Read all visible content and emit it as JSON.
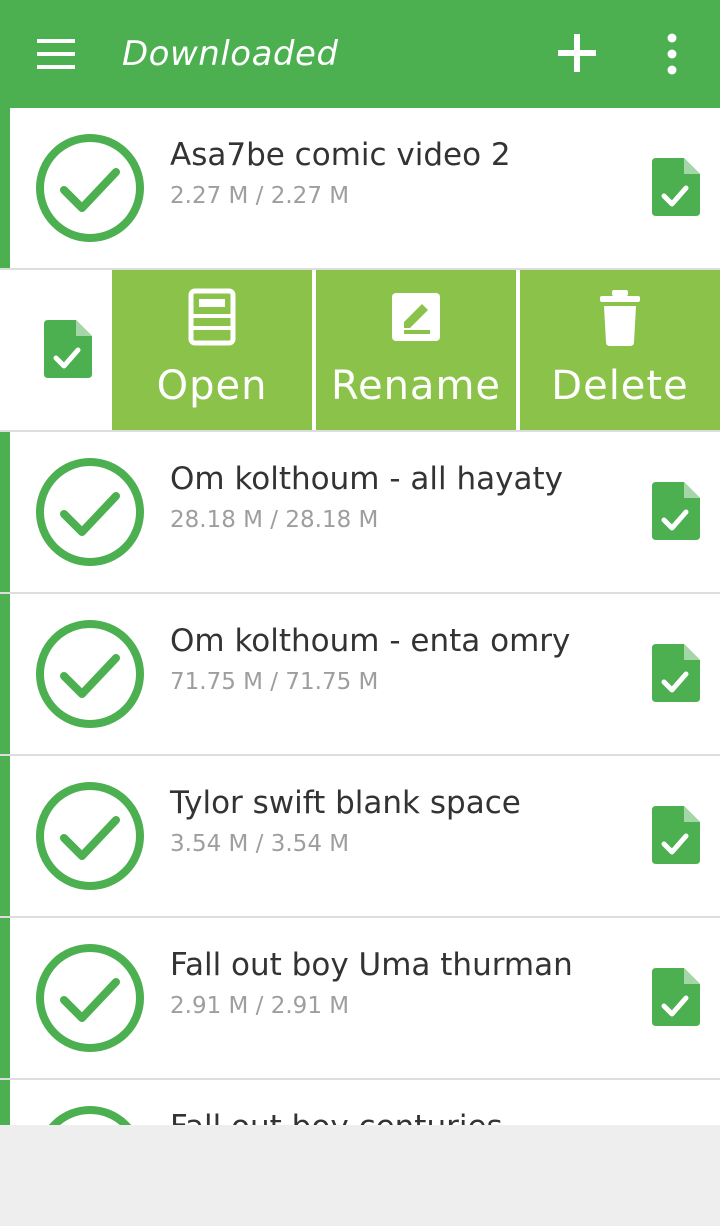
{
  "toolbar": {
    "title": "Downloaded",
    "menu_icon": "hamburger-menu-icon",
    "add_icon": "plus-icon",
    "more_icon": "overflow-menu-icon",
    "background": "#4caf50"
  },
  "swipe_actions": {
    "open_label": "Open",
    "rename_label": "Rename",
    "delete_label": "Delete",
    "background": "#8bc34a"
  },
  "downloads": [
    {
      "title": "Asa7be comic video 2",
      "size": "2.27 M / 2.27 M"
    },
    {
      "title": "Om kolthoum - all hayaty",
      "size": "28.18 M / 28.18 M"
    },
    {
      "title": "Om kolthoum - enta omry",
      "size": "71.75 M / 71.75 M"
    },
    {
      "title": "Tylor swift blank space",
      "size": "3.54 M / 3.54 M"
    },
    {
      "title": "Fall out boy Uma thurman",
      "size": "2.91 M / 2.91 M"
    },
    {
      "title": "Fall out boy centuries",
      "size": ""
    }
  ],
  "status_icons": {
    "completed": "check-circle-icon",
    "file": "file-check-icon"
  }
}
